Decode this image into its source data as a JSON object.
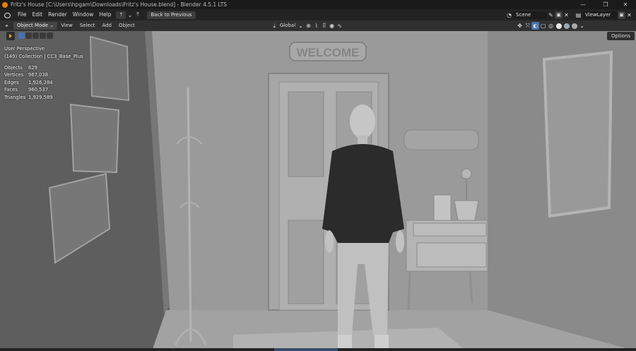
{
  "window": {
    "title": "Fritz's House [C:\\Users\\hpgam\\Downloads\\Fritz's House.blend] - Blender 4.5.1 LTS",
    "minimize": "—",
    "maximize": "❐",
    "close": "✕"
  },
  "menubar": {
    "items": [
      "File",
      "Edit",
      "Render",
      "Window",
      "Help"
    ],
    "back_button": "Back to Previous",
    "scene_label": "Scene",
    "viewlayer_label": "ViewLayer"
  },
  "header": {
    "mode": "Object Mode",
    "menus": [
      "View",
      "Select",
      "Add",
      "Object"
    ],
    "orientation": "Global",
    "options": "Options"
  },
  "overlay": {
    "view_name": "User Perspective",
    "collection": "(149) Collection | CC3_Base_Plus"
  },
  "stats": [
    {
      "label": "Objects",
      "value": "629"
    },
    {
      "label": "Vertices",
      "value": "967,038"
    },
    {
      "label": "Edges",
      "value": "1,926,284"
    },
    {
      "label": "Faces",
      "value": "960,537"
    },
    {
      "label": "Triangles",
      "value": "1,929,589"
    }
  ],
  "scene": {
    "sign_text": "WELCOME"
  },
  "colors": {
    "accent": "#e87d0d",
    "header": "#303030",
    "viewport_bg": "#8a8a8a",
    "active_blue": "#4772b3"
  }
}
